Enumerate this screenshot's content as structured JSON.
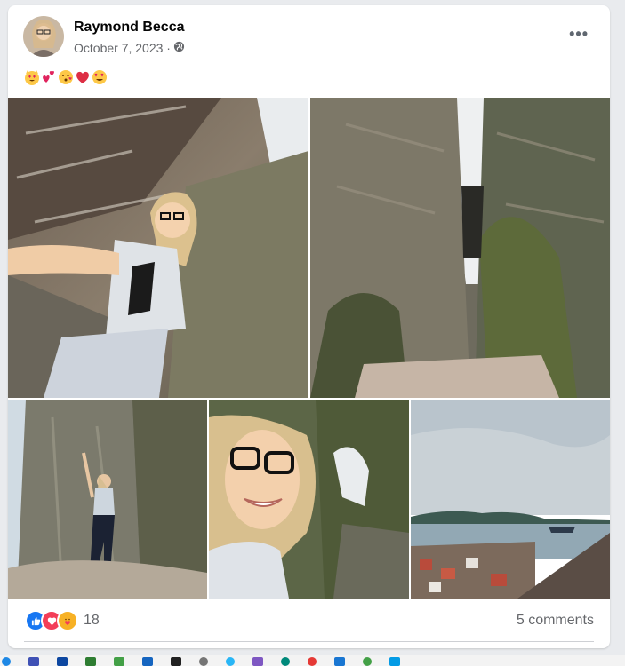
{
  "post": {
    "author": "Raymond Becca",
    "date": "October 7, 2023 ·",
    "privacy_icon": "globe-icon",
    "caption_emojis": [
      "grinning-cat-heart-eyes",
      "two-hearts",
      "face-blowing-kiss",
      "red-heart",
      "heart-eyes-face"
    ],
    "photos": [
      {
        "name": "selfie-in-rock-crevice"
      },
      {
        "name": "narrow-rock-passage"
      },
      {
        "name": "climber-on-rocks"
      },
      {
        "name": "close-up-selfie"
      },
      {
        "name": "harbor-town-view"
      }
    ],
    "reactions": {
      "types": [
        "like",
        "love",
        "care"
      ],
      "count": "18"
    },
    "comments_label": "5 comments"
  },
  "colors": {
    "like": "#1877f2",
    "love": "#f33e58",
    "care": "#f7b125"
  },
  "taskbar_icons": [
    "widgets",
    "keyboard",
    "app",
    "store",
    "app2",
    "calendar",
    "bag",
    "phone",
    "telegram",
    "mail",
    "edge",
    "chrome",
    "files",
    "whatsapp",
    "send"
  ]
}
